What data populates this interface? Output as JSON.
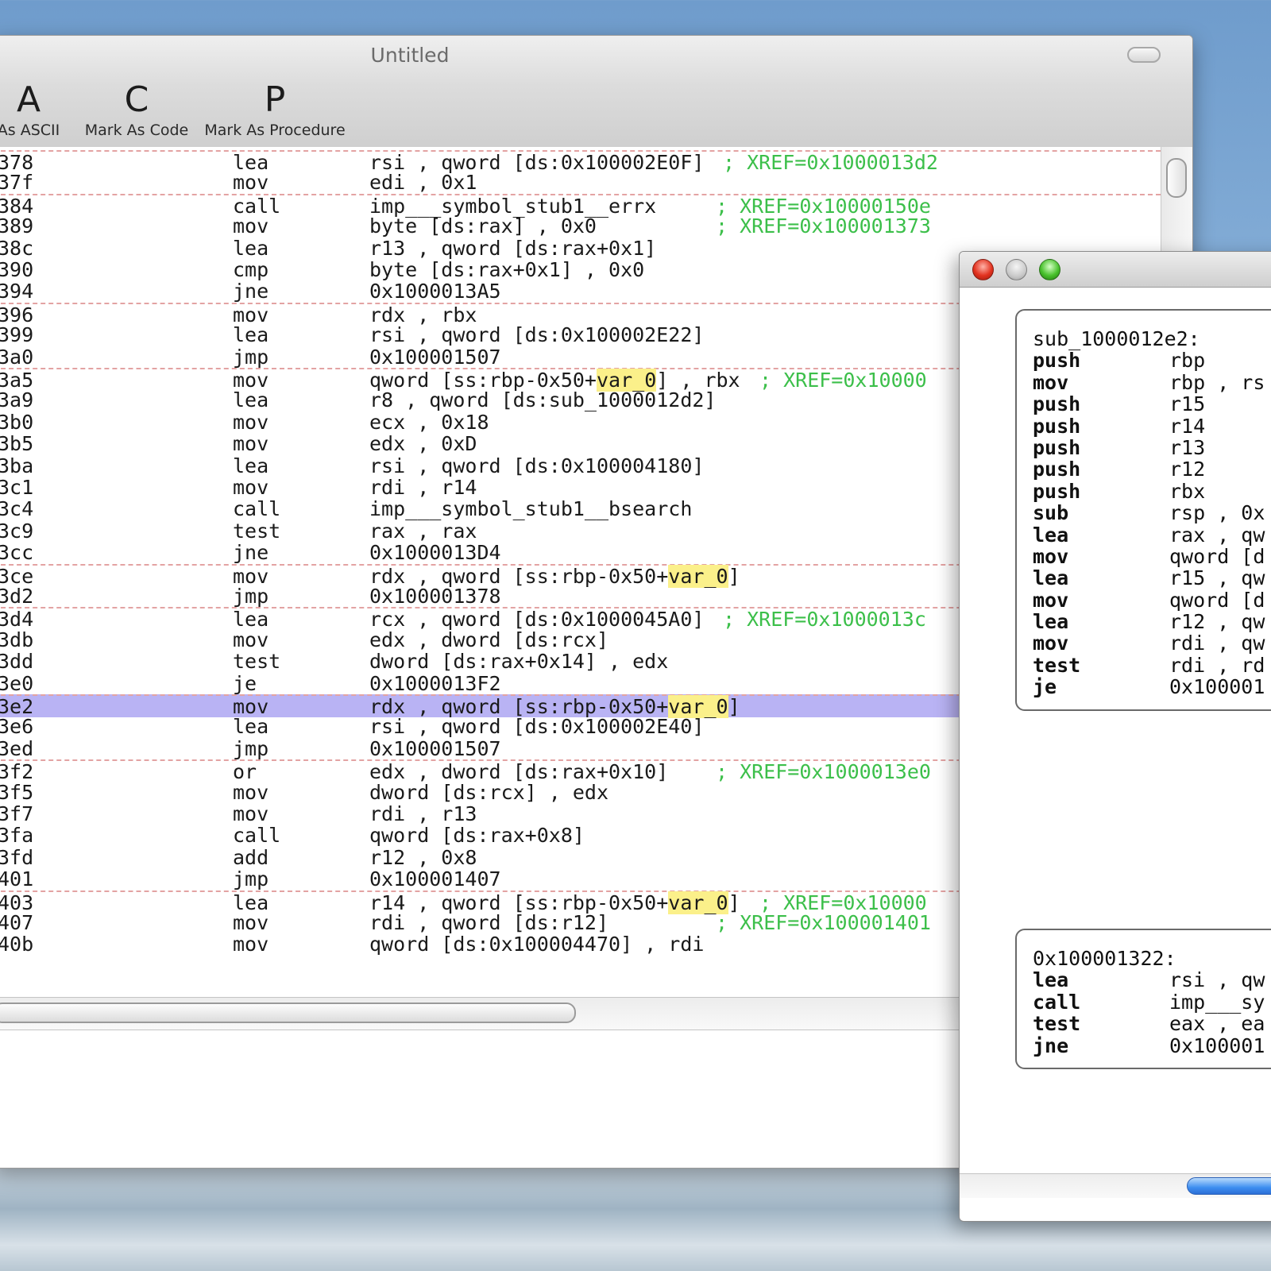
{
  "window": {
    "title": "Untitled"
  },
  "toolbar": {
    "items": [
      {
        "glyph": "A",
        "label": "As ASCII"
      },
      {
        "glyph": "C",
        "label": "Mark As Code"
      },
      {
        "glyph": "P",
        "label": "Mark As Procedure"
      }
    ]
  },
  "listing": {
    "rows": [
      {
        "addr": "378",
        "mn": "lea",
        "op": "rsi , qword [ds:0x100002E0F]",
        "hl": "",
        "op2": "",
        "cm": "; XREF=0x1000013d2",
        "sep": true,
        "sel": false
      },
      {
        "addr": "37f",
        "mn": "mov",
        "op": "edi , 0x1",
        "hl": "",
        "op2": "",
        "cm": "",
        "sep": false,
        "sel": false
      },
      {
        "addr": "384",
        "mn": "call",
        "op": "imp___symbol_stub1__errx",
        "hl": "",
        "op2": "",
        "cm": "; XREF=0x10000150e",
        "sep": true,
        "sel": false
      },
      {
        "addr": "389",
        "mn": "mov",
        "op": "byte [ds:rax] , 0x0",
        "hl": "",
        "op2": "",
        "cm": "; XREF=0x100001373",
        "sep": false,
        "sel": false
      },
      {
        "addr": "38c",
        "mn": "lea",
        "op": "r13 , qword [ds:rax+0x1]",
        "hl": "",
        "op2": "",
        "cm": "",
        "sep": false,
        "sel": false
      },
      {
        "addr": "390",
        "mn": "cmp",
        "op": "byte [ds:rax+0x1] , 0x0",
        "hl": "",
        "op2": "",
        "cm": "",
        "sep": false,
        "sel": false
      },
      {
        "addr": "394",
        "mn": "jne",
        "op": "0x1000013A5",
        "hl": "",
        "op2": "",
        "cm": "",
        "sep": false,
        "sel": false
      },
      {
        "addr": "396",
        "mn": "mov",
        "op": "rdx , rbx",
        "hl": "",
        "op2": "",
        "cm": "",
        "sep": true,
        "sel": false
      },
      {
        "addr": "399",
        "mn": "lea",
        "op": "rsi , qword [ds:0x100002E22]",
        "hl": "",
        "op2": "",
        "cm": "",
        "sep": false,
        "sel": false
      },
      {
        "addr": "3a0",
        "mn": "jmp",
        "op": "0x100001507",
        "hl": "",
        "op2": "",
        "cm": "",
        "sep": false,
        "sel": false
      },
      {
        "addr": "3a5",
        "mn": "mov",
        "op": "qword [ss:rbp-0x50+",
        "hl": "var_0",
        "op2": "] , rbx",
        "cm": "; XREF=0x10000",
        "sep": true,
        "sel": false
      },
      {
        "addr": "3a9",
        "mn": "lea",
        "op": "r8 , qword [ds:sub_1000012d2]",
        "hl": "",
        "op2": "",
        "cm": "",
        "sep": false,
        "sel": false
      },
      {
        "addr": "3b0",
        "mn": "mov",
        "op": "ecx , 0x18",
        "hl": "",
        "op2": "",
        "cm": "",
        "sep": false,
        "sel": false
      },
      {
        "addr": "3b5",
        "mn": "mov",
        "op": "edx , 0xD",
        "hl": "",
        "op2": "",
        "cm": "",
        "sep": false,
        "sel": false
      },
      {
        "addr": "3ba",
        "mn": "lea",
        "op": "rsi , qword [ds:0x100004180]",
        "hl": "",
        "op2": "",
        "cm": "",
        "sep": false,
        "sel": false
      },
      {
        "addr": "3c1",
        "mn": "mov",
        "op": "rdi , r14",
        "hl": "",
        "op2": "",
        "cm": "",
        "sep": false,
        "sel": false
      },
      {
        "addr": "3c4",
        "mn": "call",
        "op": "imp___symbol_stub1__bsearch",
        "hl": "",
        "op2": "",
        "cm": "",
        "sep": false,
        "sel": false
      },
      {
        "addr": "3c9",
        "mn": "test",
        "op": "rax , rax",
        "hl": "",
        "op2": "",
        "cm": "",
        "sep": false,
        "sel": false
      },
      {
        "addr": "3cc",
        "mn": "jne",
        "op": "0x1000013D4",
        "hl": "",
        "op2": "",
        "cm": "",
        "sep": false,
        "sel": false
      },
      {
        "addr": "3ce",
        "mn": "mov",
        "op": "rdx , qword [ss:rbp-0x50+",
        "hl": "var_0",
        "op2": "]",
        "cm": "",
        "sep": true,
        "sel": false
      },
      {
        "addr": "3d2",
        "mn": "jmp",
        "op": "0x100001378",
        "hl": "",
        "op2": "",
        "cm": "",
        "sep": false,
        "sel": false
      },
      {
        "addr": "3d4",
        "mn": "lea",
        "op": "rcx , qword [ds:0x1000045A0]",
        "hl": "",
        "op2": "",
        "cm": "; XREF=0x1000013c",
        "sep": true,
        "sel": false
      },
      {
        "addr": "3db",
        "mn": "mov",
        "op": "edx , dword [ds:rcx]",
        "hl": "",
        "op2": "",
        "cm": "",
        "sep": false,
        "sel": false
      },
      {
        "addr": "3dd",
        "mn": "test",
        "op": "dword [ds:rax+0x14] , edx",
        "hl": "",
        "op2": "",
        "cm": "",
        "sep": false,
        "sel": false
      },
      {
        "addr": "3e0",
        "mn": "je",
        "op": "0x1000013F2",
        "hl": "",
        "op2": "",
        "cm": "",
        "sep": false,
        "sel": false
      },
      {
        "addr": "3e2",
        "mn": "mov",
        "op": "rdx , qword [ss:rbp-0x50+",
        "hl": "var_0",
        "op2": "]",
        "cm": "",
        "sep": true,
        "sel": true
      },
      {
        "addr": "3e6",
        "mn": "lea",
        "op": "rsi , qword [ds:0x100002E40]",
        "hl": "",
        "op2": "",
        "cm": "",
        "sep": false,
        "sel": false
      },
      {
        "addr": "3ed",
        "mn": "jmp",
        "op": "0x100001507",
        "hl": "",
        "op2": "",
        "cm": "",
        "sep": false,
        "sel": false
      },
      {
        "addr": "3f2",
        "mn": "or",
        "op": "edx , dword [ds:rax+0x10]",
        "hl": "",
        "op2": "",
        "cm": "; XREF=0x1000013e0",
        "sep": true,
        "sel": false
      },
      {
        "addr": "3f5",
        "mn": "mov",
        "op": "dword [ds:rcx] , edx",
        "hl": "",
        "op2": "",
        "cm": "",
        "sep": false,
        "sel": false
      },
      {
        "addr": "3f7",
        "mn": "mov",
        "op": "rdi , r13",
        "hl": "",
        "op2": "",
        "cm": "",
        "sep": false,
        "sel": false
      },
      {
        "addr": "3fa",
        "mn": "call",
        "op": "qword [ds:rax+0x8]",
        "hl": "",
        "op2": "",
        "cm": "",
        "sep": false,
        "sel": false
      },
      {
        "addr": "3fd",
        "mn": "add",
        "op": "r12 , 0x8",
        "hl": "",
        "op2": "",
        "cm": "",
        "sep": false,
        "sel": false
      },
      {
        "addr": "401",
        "mn": "jmp",
        "op": "0x100001407",
        "hl": "",
        "op2": "",
        "cm": "",
        "sep": false,
        "sel": false
      },
      {
        "addr": "403",
        "mn": "lea",
        "op": "r14 , qword [ss:rbp-0x50+",
        "hl": "var_0",
        "op2": "]",
        "cm": "; XREF=0x10000",
        "sep": true,
        "sel": false
      },
      {
        "addr": "407",
        "mn": "mov",
        "op": "rdi , qword [ds:r12]",
        "hl": "",
        "op2": "",
        "cm": "; XREF=0x100001401",
        "sep": false,
        "sel": false
      },
      {
        "addr": "40b",
        "mn": "mov",
        "op": "qword [ds:0x100004470] , rdi",
        "hl": "",
        "op2": "",
        "cm": "",
        "sep": false,
        "sel": false
      }
    ]
  },
  "graph": {
    "nodes": [
      {
        "title": "sub_1000012e2:",
        "lines": [
          {
            "mn": "push",
            "op": "rbp"
          },
          {
            "mn": "mov",
            "op": "rbp , rs"
          },
          {
            "mn": "push",
            "op": "r15"
          },
          {
            "mn": "push",
            "op": "r14"
          },
          {
            "mn": "push",
            "op": "r13"
          },
          {
            "mn": "push",
            "op": "r12"
          },
          {
            "mn": "push",
            "op": "rbx"
          },
          {
            "mn": "sub",
            "op": "rsp , 0x"
          },
          {
            "mn": "lea",
            "op": "rax , qw"
          },
          {
            "mn": "mov",
            "op": "qword [d"
          },
          {
            "mn": "lea",
            "op": "r15 , qw"
          },
          {
            "mn": "mov",
            "op": "qword [d"
          },
          {
            "mn": "lea",
            "op": "r12 , qw"
          },
          {
            "mn": "mov",
            "op": "rdi , qw"
          },
          {
            "mn": "test",
            "op": "rdi , rd"
          },
          {
            "mn": "je",
            "op": "0x100001"
          }
        ]
      },
      {
        "title": "0x100001322:",
        "lines": [
          {
            "mn": "lea",
            "op": "rsi , qw"
          },
          {
            "mn": "call",
            "op": "imp___sy"
          },
          {
            "mn": "test",
            "op": "eax , ea"
          },
          {
            "mn": "jne",
            "op": "0x100001"
          }
        ]
      }
    ]
  }
}
